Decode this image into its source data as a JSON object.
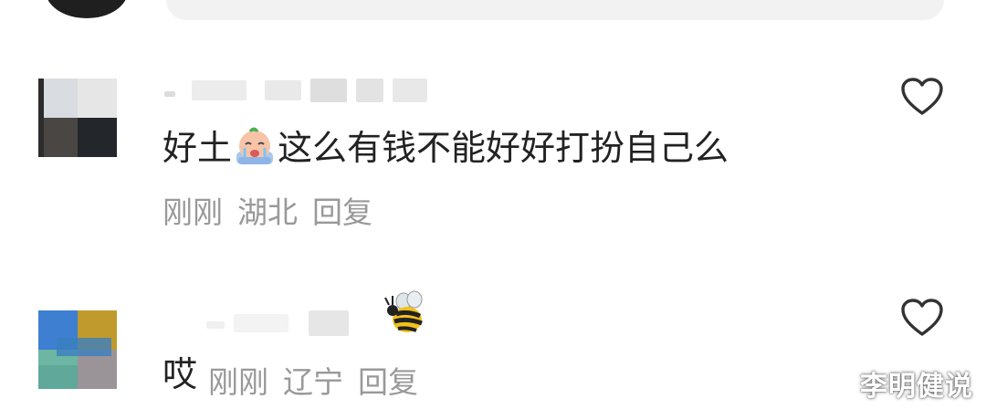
{
  "comments": [
    {
      "text_before_emoji": "好土",
      "emoji": "crying-baby-emoji",
      "text_after_emoji": "这么有钱不能好好打扮自己么",
      "time": "刚刚",
      "location": "湖北",
      "reply_label": "回复"
    },
    {
      "text": "哎",
      "time": "刚刚",
      "location": "辽宁",
      "reply_label": "回复",
      "badge_icon": "bee-icon"
    }
  ],
  "watermark": "李明健说",
  "colors": {
    "text": "#222222",
    "meta": "#999999",
    "heart": "#333333"
  }
}
